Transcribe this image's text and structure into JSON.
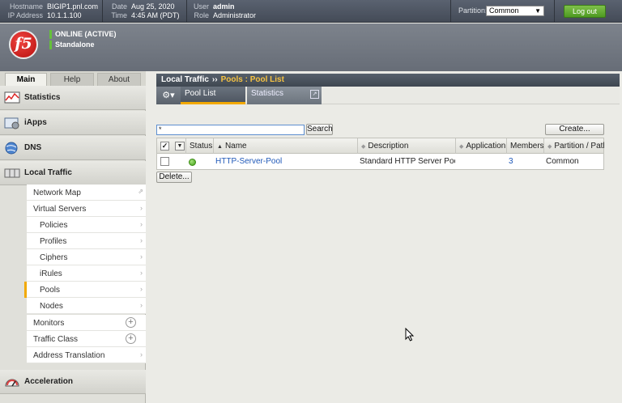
{
  "topbar": {
    "hostname_label": "Hostname",
    "hostname": "BIGIP1.pnl.com",
    "ip_label": "IP Address",
    "ip": "10.1.1.100",
    "date_label": "Date",
    "date": "Aug 25, 2020",
    "time_label": "Time",
    "time": "4:45 AM (PDT)",
    "user_label": "User",
    "user": "admin",
    "role_label": "Role",
    "role": "Administrator",
    "partition_label": "Partition:",
    "partition_value": "Common",
    "logout_label": "Log out"
  },
  "header": {
    "logo_text": "f5",
    "status_line1": "ONLINE (ACTIVE)",
    "status_line2": "Standalone",
    "status_color": "#65c03a"
  },
  "tabs": [
    {
      "label": "Main",
      "active": true
    },
    {
      "label": "Help",
      "active": false
    },
    {
      "label": "About",
      "active": false
    }
  ],
  "sidebar": {
    "sections": [
      {
        "label": "Statistics",
        "icon": "statistics-icon"
      },
      {
        "label": "iApps",
        "icon": "iapps-icon"
      },
      {
        "label": "DNS",
        "icon": "dns-globe-icon"
      },
      {
        "label": "Local Traffic",
        "icon": "local-traffic-icon"
      },
      {
        "label": "Acceleration",
        "icon": "acceleration-gauge-icon"
      }
    ],
    "items": [
      {
        "label": "Network Map"
      },
      {
        "label": "Virtual Servers"
      },
      {
        "label": "Policies"
      },
      {
        "label": "Profiles"
      },
      {
        "label": "Ciphers"
      },
      {
        "label": "iRules"
      },
      {
        "label": "Pools"
      },
      {
        "label": "Nodes"
      },
      {
        "label": "Monitors"
      },
      {
        "label": "Traffic Class"
      },
      {
        "label": "Address Translation"
      }
    ]
  },
  "content": {
    "breadcrumb_root": "Local Traffic",
    "breadcrumb_sep": "››",
    "breadcrumb_current": "Pools : Pool List",
    "subtab_pool_list": "Pool List",
    "subtab_statistics": "Statistics",
    "filter_value": "*",
    "search_label": "Search",
    "create_label": "Create...",
    "delete_label": "Delete...",
    "columns": [
      "Status",
      "Name",
      "Description",
      "Application",
      "Members",
      "Partition / Path"
    ],
    "rows": [
      {
        "status": "available",
        "name": "HTTP-Server-Pool",
        "description": "Standard HTTP Server Pool",
        "application": "",
        "members": "3",
        "partition": "Common"
      }
    ]
  },
  "colors": {
    "accent": "#f2a900",
    "link": "#1f58b8",
    "status_available": "#3f9f17",
    "logout": "#4e9a22",
    "logo_red": "#d01a17"
  }
}
